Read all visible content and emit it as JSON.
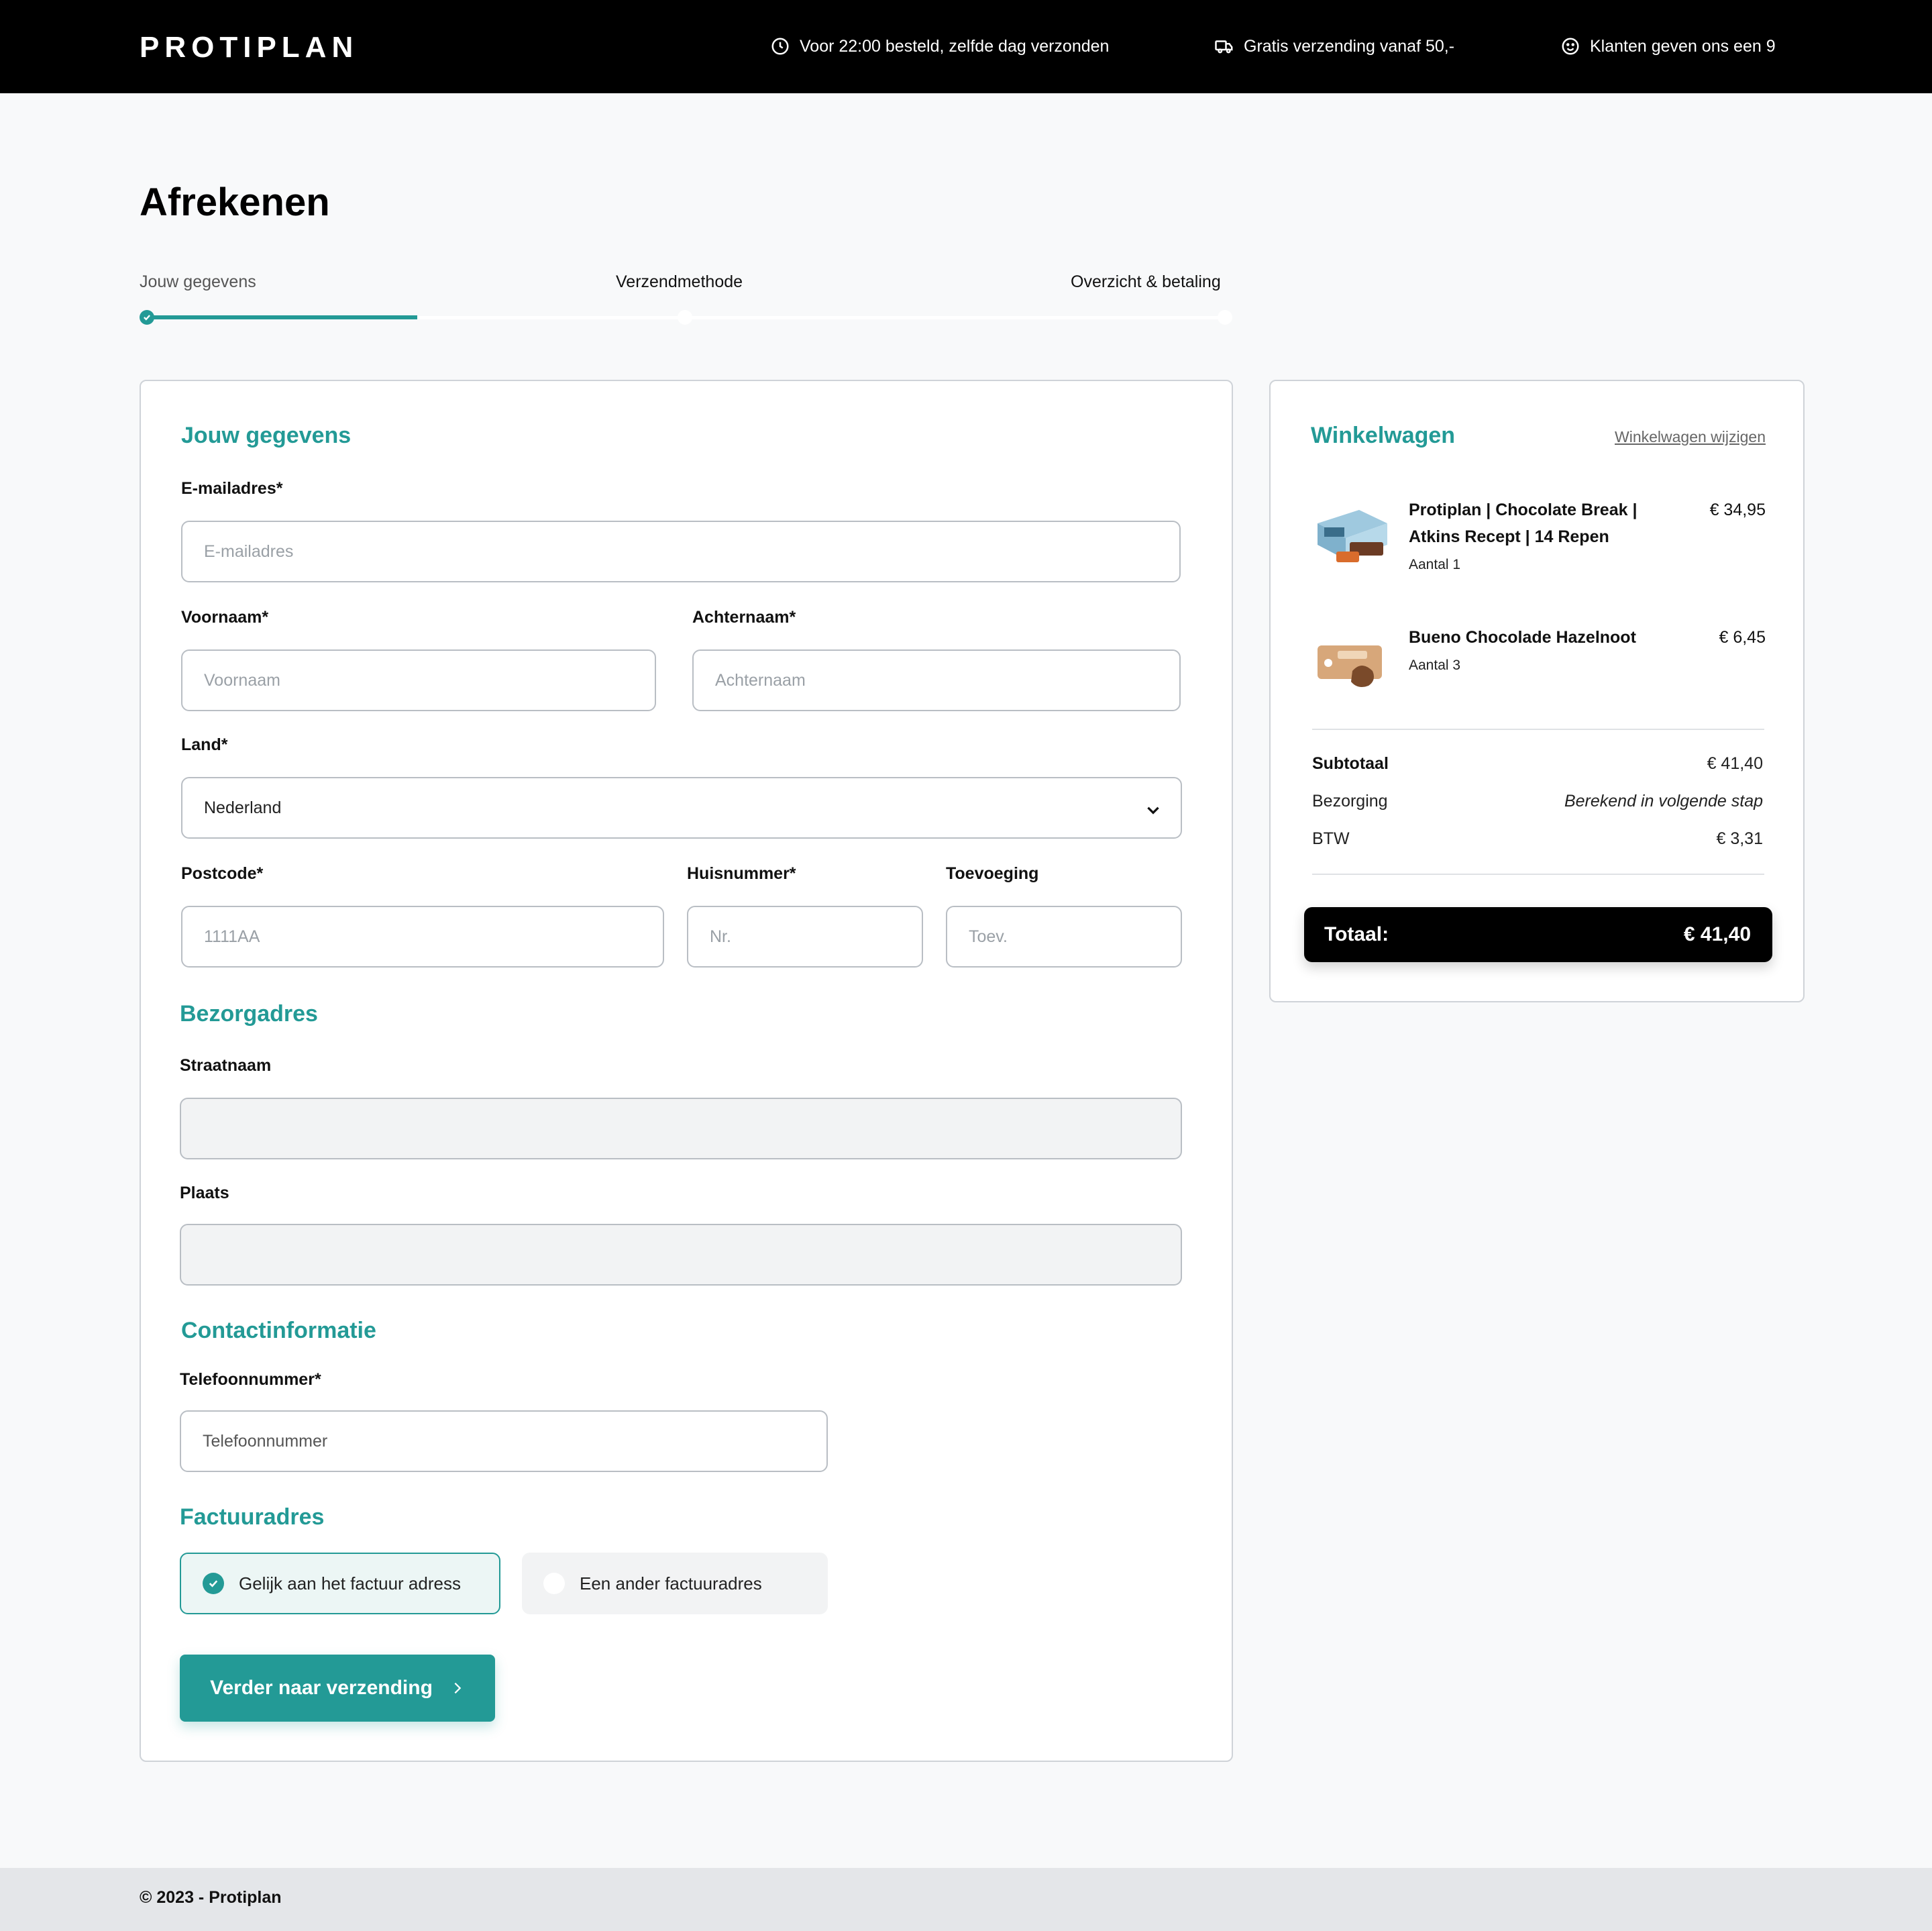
{
  "header": {
    "logo": "PROTIPLAN",
    "usps": [
      {
        "icon": "clock-icon",
        "text": "Voor 22:00 besteld, zelfde dag verzonden"
      },
      {
        "icon": "truck-icon",
        "text": "Gratis verzending vanaf 50,-"
      },
      {
        "icon": "smiley-icon",
        "text": "Klanten geven ons een 9"
      }
    ]
  },
  "page": {
    "title": "Afrekenen"
  },
  "steps": [
    {
      "label": "Jouw gegevens",
      "state": "active"
    },
    {
      "label": "Verzendmethode",
      "state": "pending"
    },
    {
      "label": "Overzicht & betaling",
      "state": "pending"
    }
  ],
  "step_progress": 0.25,
  "form": {
    "personal_title": "Jouw gegevens",
    "email": {
      "label": "E-mailadres*",
      "placeholder": "E-mailadres",
      "value": ""
    },
    "firstname": {
      "label": "Voornaam*",
      "placeholder": "Voornaam",
      "value": ""
    },
    "lastname": {
      "label": "Achternaam*",
      "placeholder": "Achternaam",
      "value": ""
    },
    "country": {
      "label": "Land*",
      "value": "Nederland"
    },
    "postcode": {
      "label": "Postcode*",
      "placeholder": "1111AA",
      "value": ""
    },
    "housenumber": {
      "label": "Huisnummer*",
      "placeholder": "Nr.",
      "value": ""
    },
    "addition": {
      "label": "Toevoeging",
      "placeholder": "Toev.",
      "value": ""
    },
    "delivery_title": "Bezorgadres",
    "street": {
      "label": "Straatnaam",
      "value": ""
    },
    "city": {
      "label": "Plaats",
      "value": ""
    },
    "contact_title": "Contactinformatie",
    "phone": {
      "label": "Telefoonnummer*",
      "placeholder": "Telefoonnummer",
      "value": ""
    },
    "billing_title": "Factuuradres",
    "billing_options": [
      {
        "label": "Gelijk aan het factuur adress",
        "selected": true
      },
      {
        "label": "Een ander factuuradres",
        "selected": false
      }
    ],
    "submit_label": "Verder naar verzending"
  },
  "cart": {
    "title": "Winkelwagen",
    "edit_link": "Winkelwagen wijzigen",
    "items": [
      {
        "name": "Protiplan | Chocolate Break | Atkins Recept | 14 Repen",
        "qty": "Aantal 1",
        "price": "€ 34,95"
      },
      {
        "name": "Bueno Chocolade Hazelnoot",
        "qty": "Aantal 3",
        "price": "€ 6,45"
      }
    ],
    "subtotal_label": "Subtotaal",
    "subtotal_value": "€ 41,40",
    "shipping_label": "Bezorging",
    "shipping_value": "Berekend in volgende stap",
    "vat_label": "BTW",
    "vat_value": "€ 3,31",
    "total_label": "Totaal:",
    "total_value": "€ 41,40"
  },
  "footer": {
    "text": "© 2023 - Protiplan"
  },
  "colors": {
    "accent": "#239a96",
    "header_bg": "#000000",
    "footer_bg": "#e4e6e9"
  }
}
